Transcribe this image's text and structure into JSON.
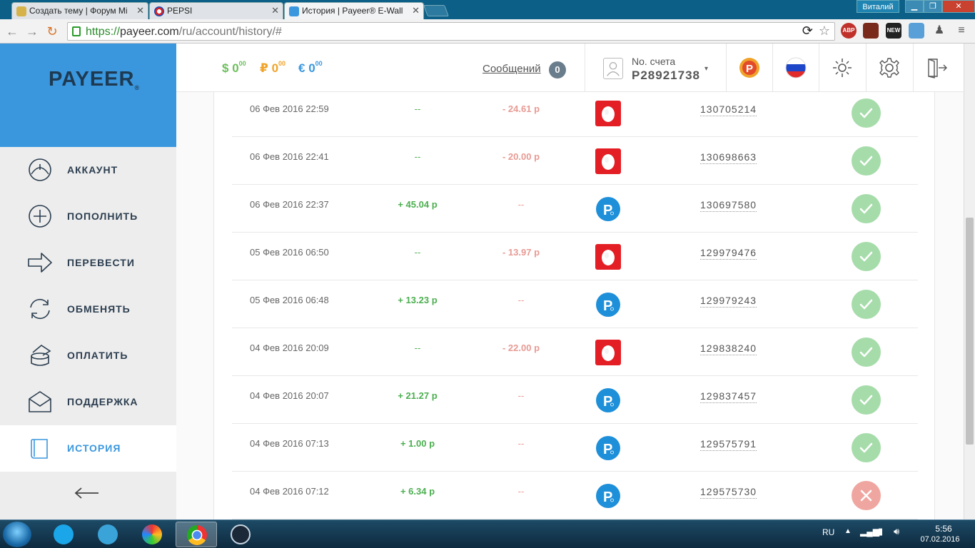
{
  "browser": {
    "tabs": [
      {
        "title": "Создать тему | Форум Mi",
        "active": false
      },
      {
        "title": "PEPSI",
        "active": false
      },
      {
        "title": "История | Payeer® E-Wall",
        "active": true
      }
    ],
    "user": "Виталий",
    "url_scheme": "https://",
    "url_host": "payeer.com",
    "url_path": "/ru/account/history/#",
    "extensions": [
      "ABP",
      "NEW"
    ]
  },
  "sidebar": {
    "logo": "PAYEER",
    "items": [
      {
        "label": "АККАУНТ",
        "icon": "dashboard-gauge-icon"
      },
      {
        "label": "ПОПОЛНИТЬ",
        "icon": "plus-circle-icon"
      },
      {
        "label": "ПЕРЕВЕСТИ",
        "icon": "arrow-right-icon"
      },
      {
        "label": "ОБМЕНЯТЬ",
        "icon": "refresh-exchange-icon"
      },
      {
        "label": "ОПЛАТИТЬ",
        "icon": "coins-stack-icon"
      },
      {
        "label": "ПОДДЕРЖКА",
        "icon": "envelope-icon"
      },
      {
        "label": "ИСТОРИЯ",
        "icon": "book-icon",
        "active": true
      }
    ]
  },
  "header": {
    "balances": [
      {
        "symbol": "$",
        "amount": "0",
        "cents": "00",
        "color": "#6cbf5b"
      },
      {
        "symbol": "₽",
        "amount": "0",
        "cents": "00",
        "color": "#f0a32a"
      },
      {
        "symbol": "€",
        "amount": "0",
        "cents": "00",
        "color": "#3a97de"
      }
    ],
    "messages_label": "Сообщений",
    "messages_count": "0",
    "account_label": "No. счета",
    "account_number": "P28921738"
  },
  "history": {
    "rows": [
      {
        "date": "06 Фев 2016 22:59",
        "income": "--",
        "expense": "- 24.61 р",
        "system": "mts",
        "id": "130705214",
        "status": "success"
      },
      {
        "date": "06 Фев 2016 22:41",
        "income": "--",
        "expense": "- 20.00 р",
        "system": "mts",
        "id": "130698663",
        "status": "success"
      },
      {
        "date": "06 Фев 2016 22:37",
        "income": "+ 45.04 р",
        "expense": "--",
        "system": "payeer",
        "id": "130697580",
        "status": "success"
      },
      {
        "date": "05 Фев 2016 06:50",
        "income": "--",
        "expense": "- 13.97 р",
        "system": "mts",
        "id": "129979476",
        "status": "success"
      },
      {
        "date": "05 Фев 2016 06:48",
        "income": "+ 13.23 р",
        "expense": "--",
        "system": "payeer",
        "id": "129979243",
        "status": "success"
      },
      {
        "date": "04 Фев 2016 20:09",
        "income": "--",
        "expense": "- 22.00 р",
        "system": "mts",
        "id": "129838240",
        "status": "success"
      },
      {
        "date": "04 Фев 2016 20:07",
        "income": "+ 21.27 р",
        "expense": "--",
        "system": "payeer",
        "id": "129837457",
        "status": "success"
      },
      {
        "date": "04 Фев 2016 07:13",
        "income": "+ 1.00 р",
        "expense": "--",
        "system": "payeer",
        "id": "129575791",
        "status": "success"
      },
      {
        "date": "04 Фев 2016 07:12",
        "income": "+ 6.34 р",
        "expense": "--",
        "system": "payeer",
        "id": "129575730",
        "status": "failed"
      }
    ]
  },
  "taskbar": {
    "apps": [
      "skype-icon",
      "telegram-icon",
      "game-icon",
      "chrome-icon",
      "steam-icon"
    ],
    "language": "RU",
    "time": "5:56",
    "date": "07.02.2016"
  }
}
